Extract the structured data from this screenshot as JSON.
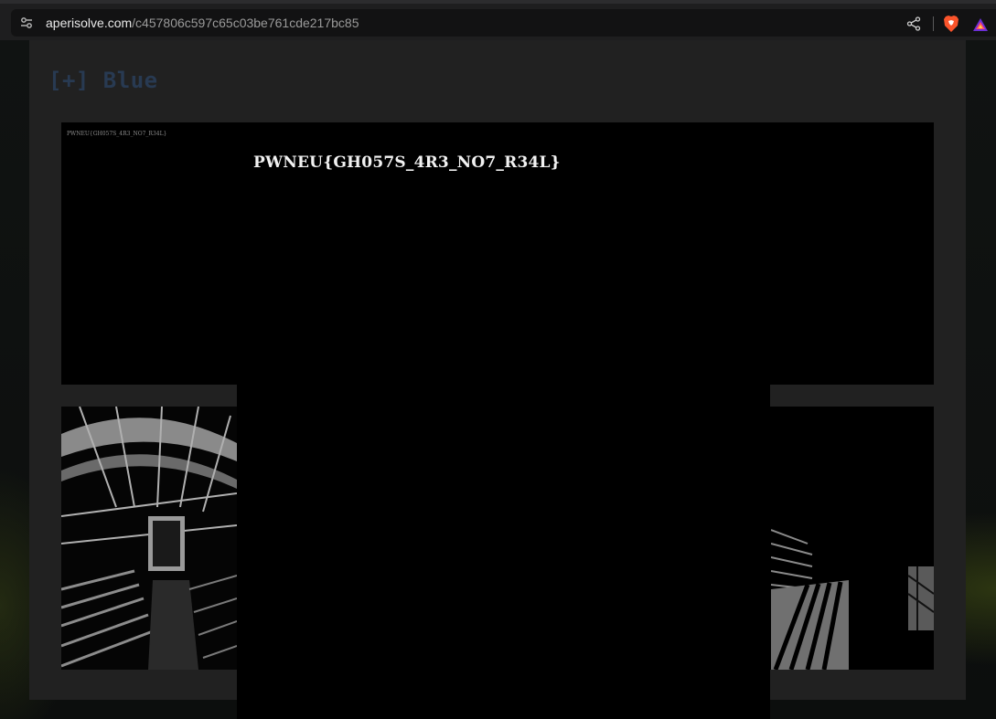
{
  "browser": {
    "url_domain": "aperisolve.com",
    "url_path": "/c457806c597c65c03be761cde217bc85",
    "icons": [
      "tune-icon",
      "share-icon",
      "brave-shield-icon",
      "brave-rewards-icon"
    ]
  },
  "section": {
    "title": "[+] Blue"
  },
  "panels": {
    "tiny_flag": "PWNEU{GH057S_4R3_NO7_R34L}"
  },
  "overlay": {
    "flag_text": "PWNEU{GH057S_4R3_NO7_R34L}"
  },
  "colors": {
    "title": "#283a52",
    "card": "#212121",
    "image_bg": "#000000",
    "flag": "#f2f2f2"
  }
}
